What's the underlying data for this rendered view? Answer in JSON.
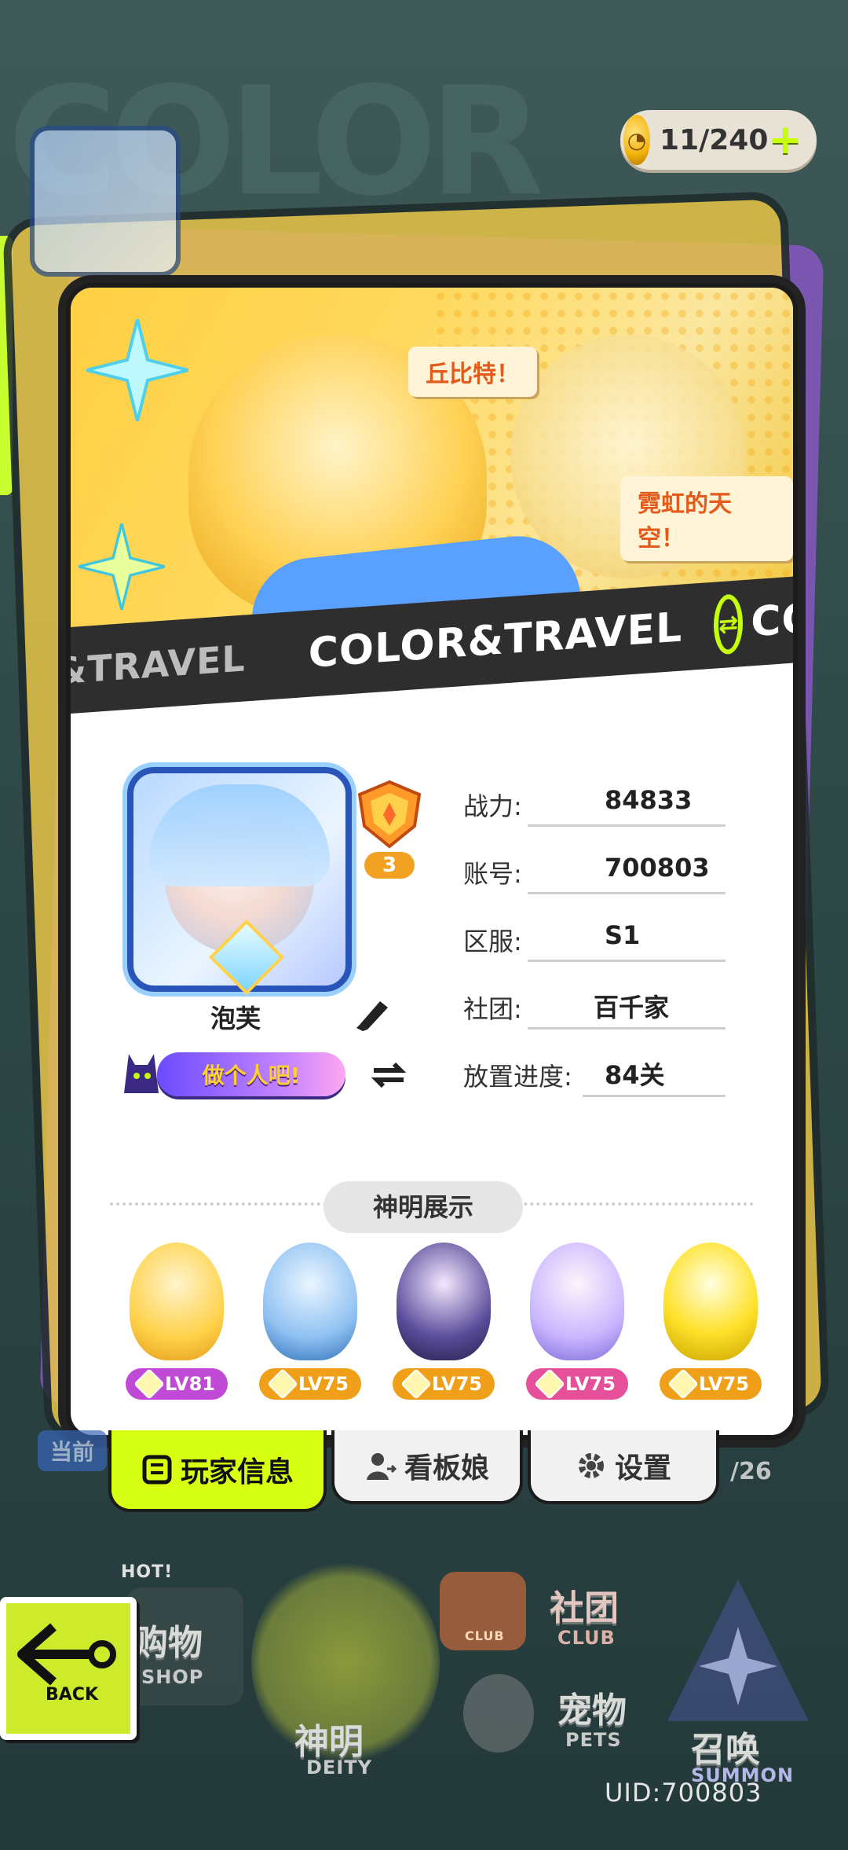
{
  "currency": {
    "amount": "11/240",
    "plus": "+"
  },
  "banner": {
    "speech1": "丘比特！",
    "speech2": "霓虹的天空！",
    "ribbon_left": "&TRAVEL",
    "ribbon_main": "COLOR&TRAVEL",
    "ribbon_right": "CO"
  },
  "player": {
    "name": "泡芙",
    "rank_level": "3",
    "motto": "做个人吧!"
  },
  "stats": [
    {
      "label": "战力:",
      "value": "84833"
    },
    {
      "label": "账号:",
      "value": "700803"
    },
    {
      "label": "区服:",
      "value": "S1"
    },
    {
      "label": "社团:",
      "value": "百千家"
    },
    {
      "label": "放置进度:",
      "value": "84关"
    }
  ],
  "deity_section": {
    "title": "神明展示",
    "items": [
      {
        "level": "LV81",
        "color": "#c04ad6"
      },
      {
        "level": "LV75",
        "color": "#f0a018"
      },
      {
        "level": "LV75",
        "color": "#f0a018"
      },
      {
        "level": "LV75",
        "color": "#e6509a"
      },
      {
        "level": "LV75",
        "color": "#f0a018"
      }
    ]
  },
  "tabs": [
    {
      "label": "玩家信息",
      "active": true
    },
    {
      "label": "看板娘",
      "active": false
    },
    {
      "label": "设置",
      "active": false
    }
  ],
  "side_labels": {
    "left": "当前",
    "right": "/26"
  },
  "bottom_nav": {
    "back": "BACK",
    "shop_cn": "购物",
    "shop_en": "SHOP",
    "hot": "HOT!",
    "deity_cn": "神明",
    "deity_en": "DEITY",
    "club_cn": "社团",
    "club_en": "CLUB",
    "club_badge": "CLUB",
    "pets_cn": "宠物",
    "pets_en": "PETS",
    "summon_cn": "召唤",
    "summon_en": "SUMMON"
  },
  "uid": "UID:700803",
  "colors": {
    "accent": "#d6ff12",
    "card_bg": "#ffffff",
    "banner": "#ffcf42"
  }
}
